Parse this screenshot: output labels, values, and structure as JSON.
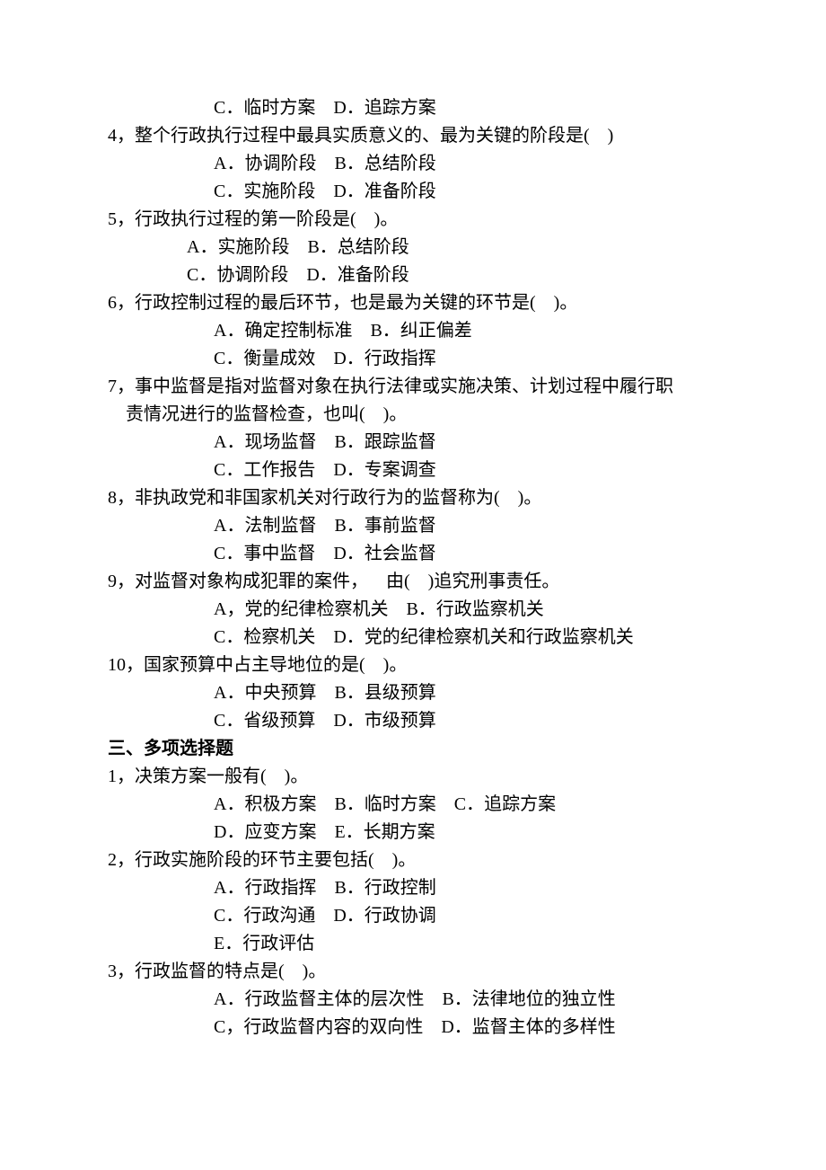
{
  "lines": {
    "q3_opts_cd": "C．临时方案    D．追踪方案",
    "q4_stem": "4，整个行政执行过程中最具实质意义的、最为关键的阶段是(    )",
    "q4_opts_ab": "A．协调阶段    B．总结阶段",
    "q4_opts_cd": "C．实施阶段    D．准备阶段",
    "q5_stem": "5，行政执行过程的第一阶段是(    )。",
    "q5_opts_ab": "A．实施阶段    B．总结阶段",
    "q5_opts_cd": "C．协调阶段    D．准备阶段",
    "q6_stem": "6，行政控制过程的最后环节，也是最为关键的环节是(    )。",
    "q6_opts_ab": "A．确定控制标准    B．纠正偏差",
    "q6_opts_cd": "C．衡量成效    D．行政指挥",
    "q7_stem1": "7，事中监督是指对监督对象在执行法律或实施决策、计划过程中履行职",
    "q7_stem2": "    责情况进行的监督检查，也叫(    )。",
    "q7_opts_ab": "A．现场监督    B．跟踪监督",
    "q7_opts_cd": "C．工作报告    D．专案调查",
    "q8_stem": "8，非执政党和非国家机关对行政行为的监督称为(    )。",
    "q8_opts_ab": "A．法制监督    B．事前监督",
    "q8_opts_cd": "C．事中监督    D．社会监督",
    "q9_stem": "9，对监督对象构成犯罪的案件，    由(    )追究刑事责任。",
    "q9_opts_ab": "A，党的纪律检察机关    B．行政监察机关",
    "q9_opts_cd": "C．检察机关    D．党的纪律检察机关和行政监察机关",
    "q10_stem": "10，国家预算中占主导地位的是(    )。",
    "q10_opts_ab": "A．中央预算    B．县级预算",
    "q10_opts_cd": "C．省级预算    D．市级预算",
    "section3": "三、多项选择题",
    "m1_stem": "1，决策方案一般有(    )。",
    "m1_opts_abc": "A．积极方案    B．临时方案    C．追踪方案",
    "m1_opts_de": "D．应变方案    E．长期方案",
    "m2_stem": "2，行政实施阶段的环节主要包括(    )。",
    "m2_opts_ab": "A．行政指挥    B．行政控制",
    "m2_opts_cd": "C．行政沟通    D．行政协调",
    "m2_opts_e": "E．行政评估",
    "m3_stem": "3，行政监督的特点是(    )。",
    "m3_opts_ab": "A．行政监督主体的层次性    B．法律地位的独立性",
    "m3_opts_cd": "C，行政监督内容的双向性    D．监督主体的多样性"
  }
}
